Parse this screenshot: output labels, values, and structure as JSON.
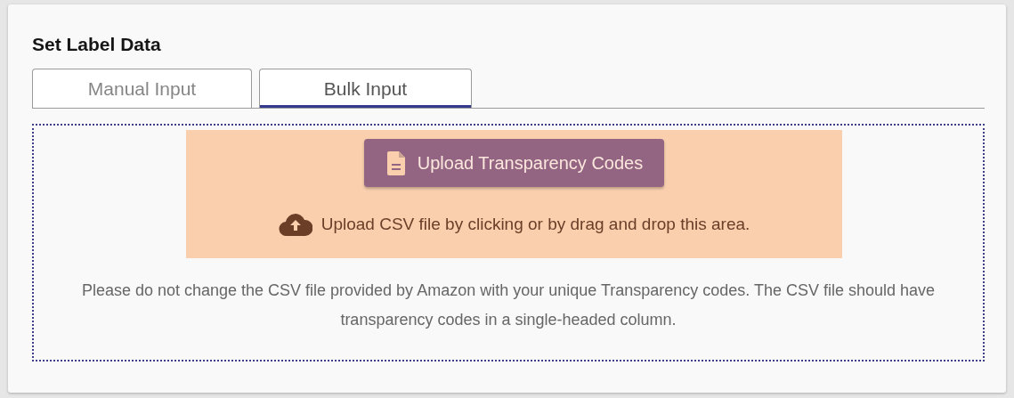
{
  "card": {
    "title": "Set Label Data"
  },
  "tabs": [
    {
      "label": "Manual Input",
      "selected": false
    },
    {
      "label": "Bulk Input",
      "selected": true
    }
  ],
  "upload": {
    "button": "Upload Transparency Codes",
    "hint": "Upload CSV file by clicking or by drag and drop this area."
  },
  "note": "Please do not change the CSV file provided by Amazon with your unique Transparency codes. The CSV file should have transparency codes in a single-headed column."
}
